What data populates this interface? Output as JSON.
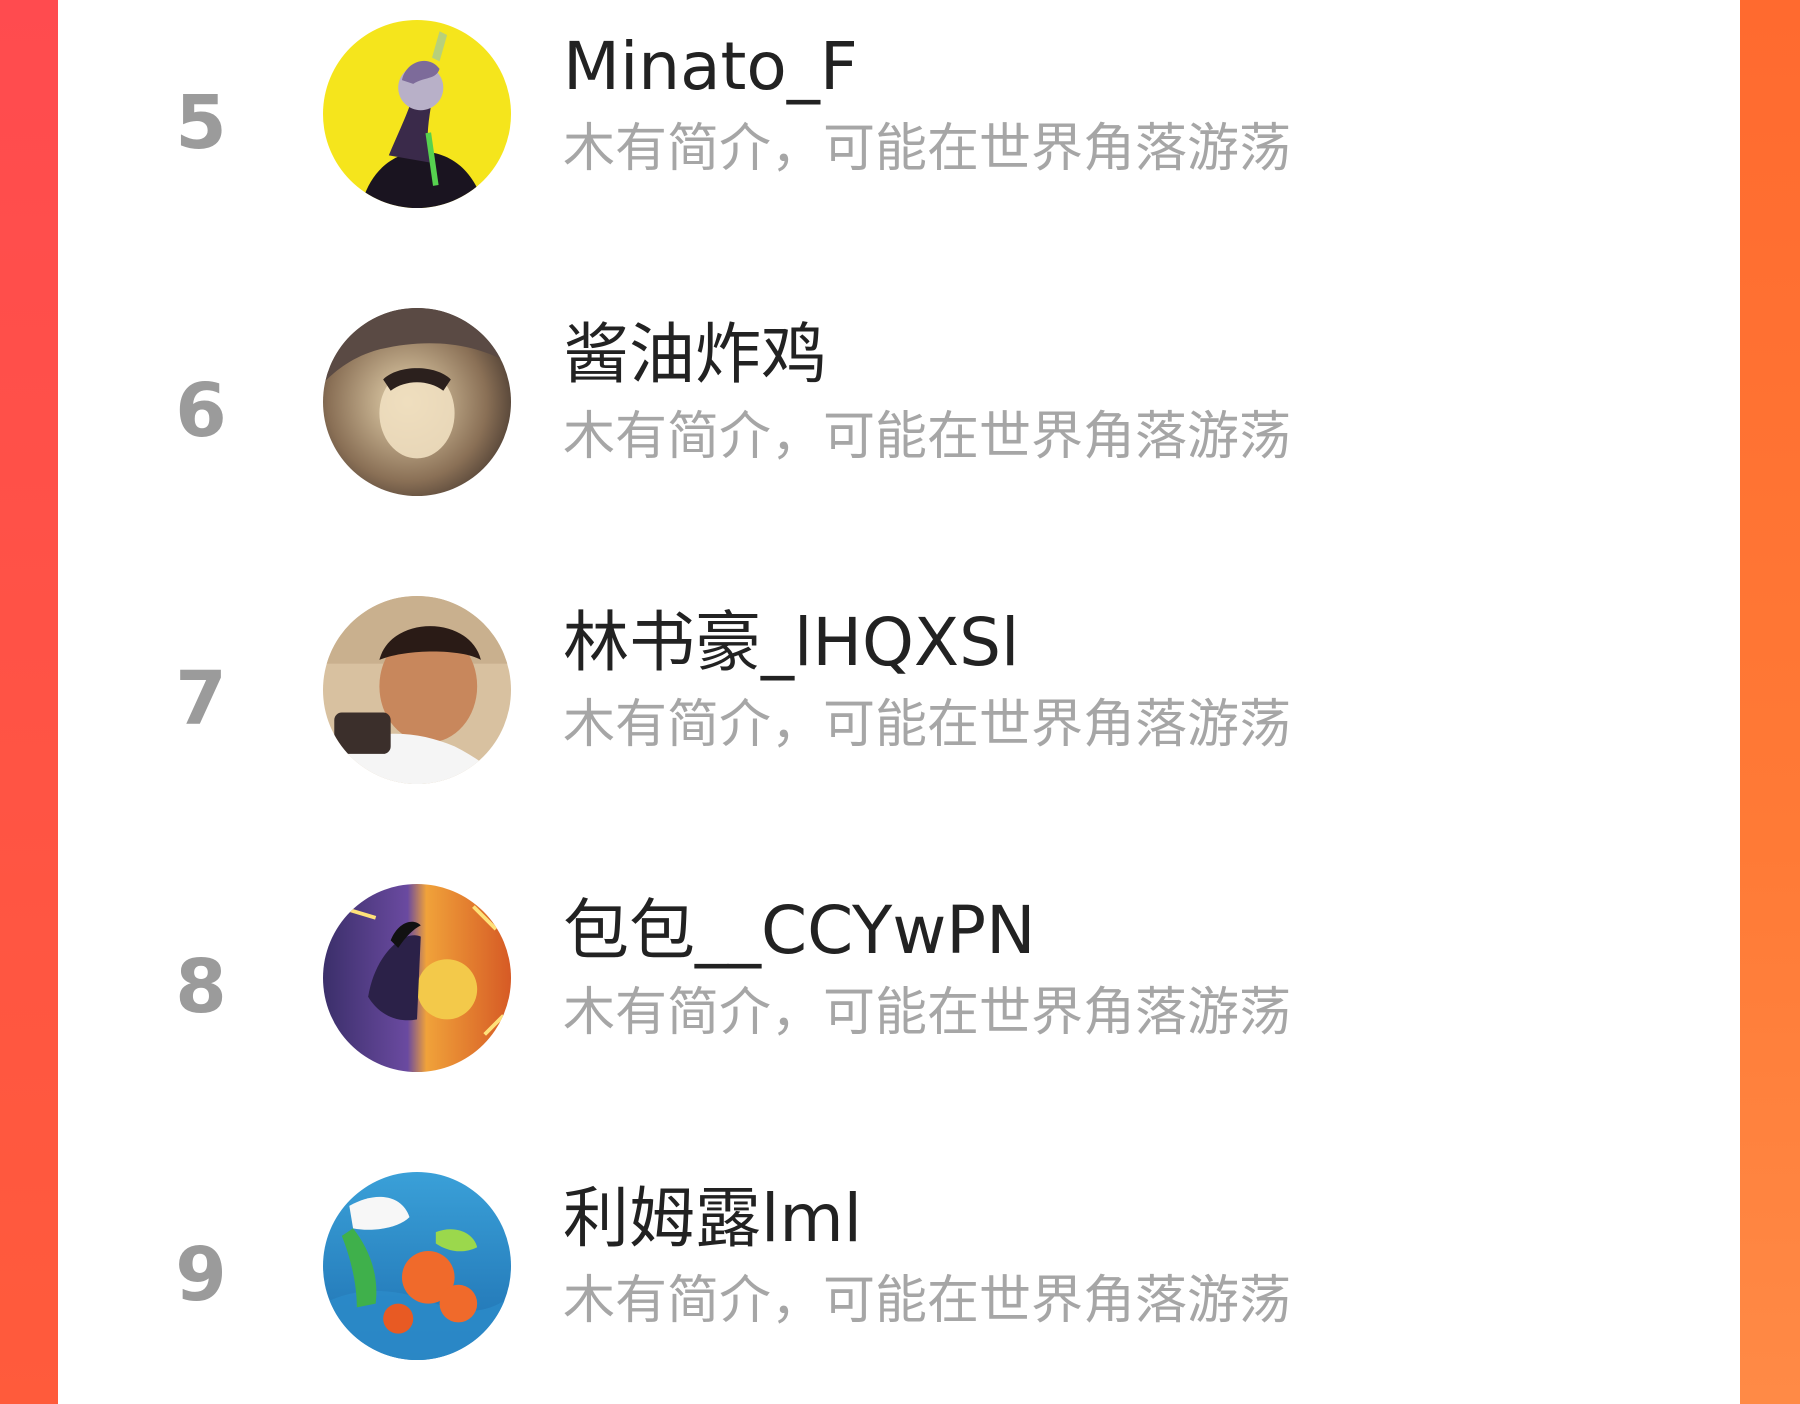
{
  "colors": {
    "accent_left": "#ff4d4f",
    "accent_right": "#ff7a36",
    "rank": "#9b9b9b",
    "name": "#222222",
    "bio": "#a6a6a6"
  },
  "ranking": {
    "items": [
      {
        "rank": "5",
        "name": "Minato_F",
        "bio": "木有简介，可能在世界角落游荡",
        "avatar": "avatar-minato"
      },
      {
        "rank": "6",
        "name": "酱油炸鸡",
        "bio": "木有简介，可能在世界角落游荡",
        "avatar": "avatar-jiangyou"
      },
      {
        "rank": "7",
        "name": "林书豪_lHQXSl",
        "bio": "木有简介，可能在世界角落游荡",
        "avatar": "avatar-lin"
      },
      {
        "rank": "8",
        "name": "包包__CCYwPN",
        "bio": "木有简介，可能在世界角落游荡",
        "avatar": "avatar-baobao"
      },
      {
        "rank": "9",
        "name": "利姆露lml",
        "bio": "木有简介，可能在世界角落游荡",
        "avatar": "avatar-limulu"
      }
    ]
  }
}
